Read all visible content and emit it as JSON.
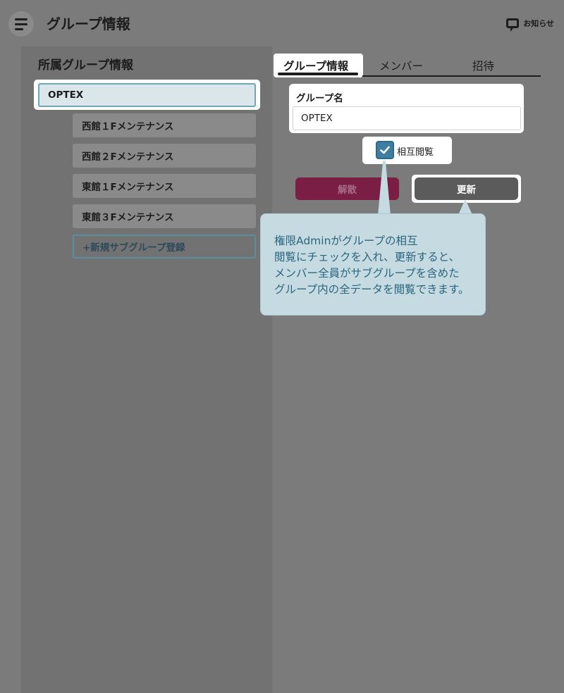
{
  "header": {
    "title": "グループ情報",
    "notice_label": "お知らせ"
  },
  "left": {
    "section_title": "所属グループ情報",
    "main_group": "OPTEX",
    "sub_groups": [
      "西館１Fメンテナンス",
      "西館２Fメンテナンス",
      "東館１Fメンテナンス",
      "東館３Fメンテナンス"
    ],
    "add_sub_group": "+新規サブグループ登録"
  },
  "tabs": [
    {
      "label": "グループ情報",
      "active": true
    },
    {
      "label": "メンバー",
      "active": false
    },
    {
      "label": "招待",
      "active": false
    }
  ],
  "form": {
    "group_name_label": "グループ名",
    "group_name_value": "OPTEX",
    "mutual_view_label": "相互閲覧",
    "mutual_view_checked": true,
    "dissolve_label": "解散",
    "update_label": "更新"
  },
  "callout": {
    "lines": [
      "権限Adminがグループの相互",
      "閲覧にチェックを入れ、更新すると、",
      "メンバー全員がサブグループを含めた",
      "グループ内の全データを閲覧できます。"
    ]
  },
  "colors": {
    "overlay_gray": "#7b7b7b",
    "callout_bg": "#c6dbe1",
    "callout_text": "#2b6681",
    "checkbox_blue": "#3e7ea0",
    "dissolve_button": "#7a1e46",
    "update_button": "#5b5b5b"
  }
}
